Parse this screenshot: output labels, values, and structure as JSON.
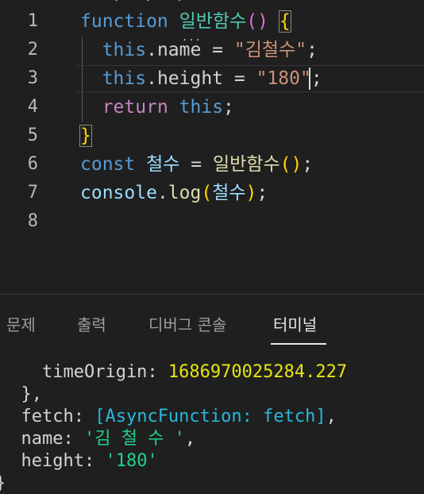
{
  "editor": {
    "top_clip": "·  ·  ·",
    "line_numbers": [
      "1",
      "2",
      "3",
      "4",
      "5",
      "6",
      "7",
      "8"
    ],
    "l1": {
      "kw": "function",
      "name": "일반함수",
      "parens": "()",
      "brace": "{"
    },
    "l2": {
      "this": "this",
      "rest": ".name = ",
      "str": "\"김철수\"",
      "semi": ";"
    },
    "l3": {
      "this": "this",
      "rest": ".height = ",
      "str": "\"180\"",
      "semi": ";"
    },
    "l4": {
      "ret": "return",
      "this": "this",
      "semi": ";"
    },
    "l5": {
      "brace": "}"
    },
    "l6": {
      "kw": "const",
      "var": " 철수",
      "eq": " = ",
      "call": "일반함수",
      "parens": "()",
      "semi": ";"
    },
    "l7": {
      "obj": "console",
      "dot": ".",
      "fn": "log",
      "open": "(",
      "arg": "철수",
      "close": ")",
      "semi": ";"
    },
    "ellipsis": "..."
  },
  "panel": {
    "tabs": [
      {
        "label": "문제"
      },
      {
        "label": "출력"
      },
      {
        "label": "디버그 콘솔"
      },
      {
        "label": "터미널"
      }
    ],
    "active_tab": "터미널"
  },
  "terminal": {
    "t1_key": "    timeOrigin: ",
    "t1_val": "1686970025284.227",
    "t2": "  },",
    "t3_key": "  fetch: ",
    "t3_val": "[AsyncFunction: fetch]",
    "t3_end": ",",
    "t4_key": "  name: ",
    "t4_val": "'김 철 수 '",
    "t4_end": ",",
    "t5_key": "  height: ",
    "t5_val": "'180'",
    "t6": "}"
  },
  "colors": {
    "keyword": "#569cd6",
    "function_decl": "#4ec9b0",
    "control": "#c586c0",
    "string": "#ce9178",
    "bracket": "#ffd700",
    "terminal_number": "#e5e510",
    "terminal_cyan": "#29b8db",
    "terminal_green": "#23d18b"
  }
}
